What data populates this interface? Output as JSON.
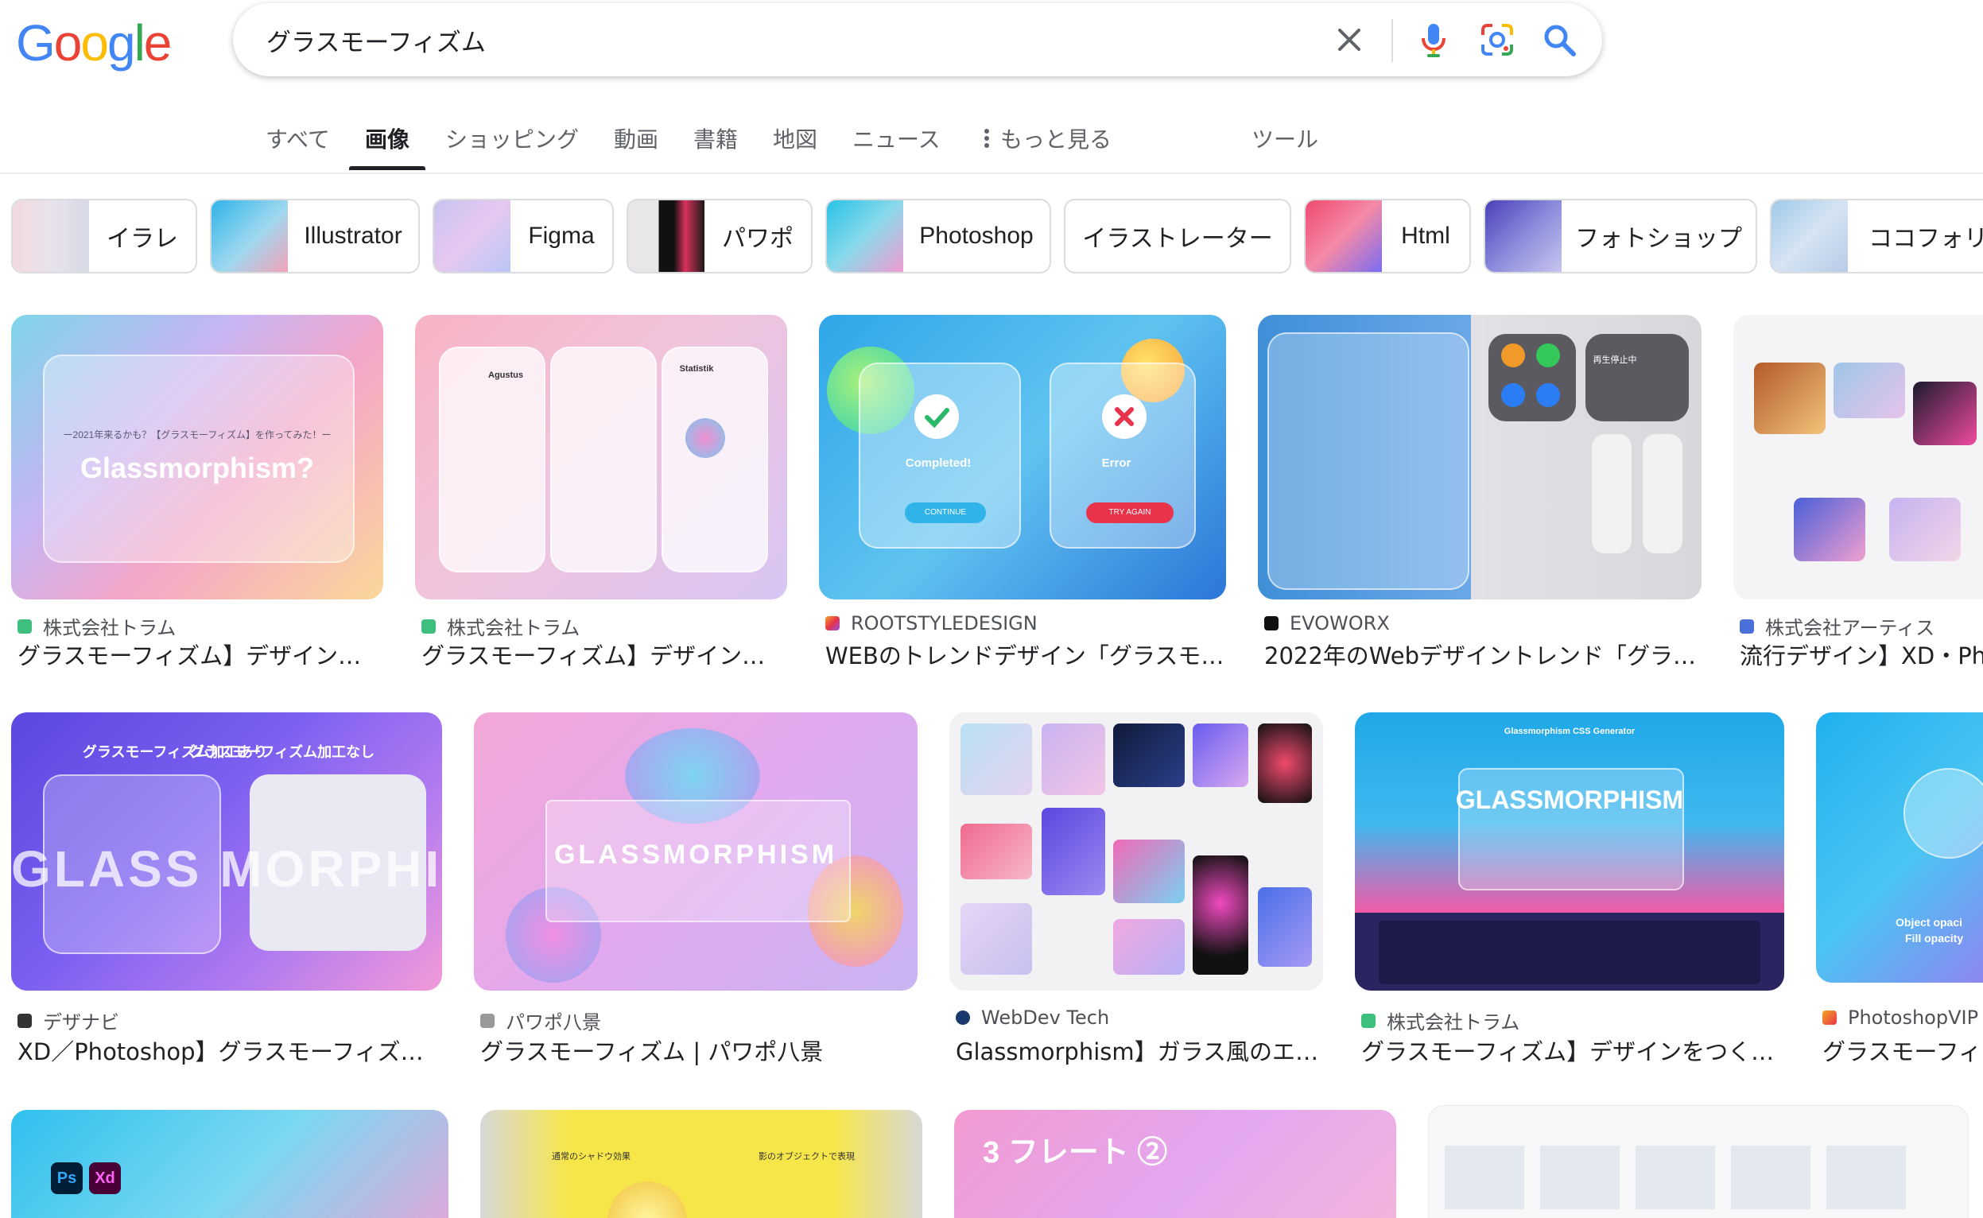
{
  "logo": "Google",
  "search": {
    "query": "グラスモーフィズム"
  },
  "tabs": [
    {
      "label": "すべて"
    },
    {
      "label": "画像"
    },
    {
      "label": "ショッピング"
    },
    {
      "label": "動画"
    },
    {
      "label": "書籍"
    },
    {
      "label": "地図"
    },
    {
      "label": "ニュース"
    },
    {
      "label": "もっと見る"
    },
    {
      "label": "ツール"
    }
  ],
  "active_tab": "画像",
  "chips": [
    {
      "label": "イラレ"
    },
    {
      "label": "Illustrator"
    },
    {
      "label": "Figma"
    },
    {
      "label": "パワポ"
    },
    {
      "label": "Photoshop"
    },
    {
      "label": "イラストレーター"
    },
    {
      "label": "Html"
    },
    {
      "label": "フォトショップ"
    },
    {
      "label": "ココフォリア"
    }
  ],
  "results": [
    {
      "source": "株式会社トラム",
      "title": "グラスモーフィズム】デザインを…",
      "thumb_text": "Glassmorphism?",
      "thumb_sub": "ー2021年来るかも？【グラスモーフィズム】を作ってみた！ー"
    },
    {
      "source": "株式会社トラム",
      "title": "グラスモーフィズム】デザインを…",
      "thumb_text": "Agustus",
      "thumb_sub": "Statistik"
    },
    {
      "source": "ROOTSTYLEDESIGN",
      "title": "WEBのトレンドデザイン「グラスモ…",
      "thumb_text": "Completed!",
      "thumb_sub": "Error",
      "btn1": "CONTINUE",
      "btn2": "TRY AGAIN"
    },
    {
      "source": "EVOWORX",
      "title": "2022年のWebデザイントレンド「グラ…",
      "thumb_text": "再生停止中"
    },
    {
      "source": "株式会社アーティス",
      "title": "流行デザイン】XD・Pho"
    },
    {
      "source": "デザナビ",
      "title": "XD／Photoshop】グラスモーフィズム…",
      "thumb_text": "グラスモーフィズム加工あり",
      "thumb_sub": "グラスモーフィズム加工なし",
      "thumb_big": "GLASS MORPHISM"
    },
    {
      "source": "パワポ八景",
      "title": "グラスモーフィズム | パワポ八景",
      "thumb_text": "GLASSMORPHISM"
    },
    {
      "source": "WebDev Tech",
      "title": "Glassmorphism】ガラス風のエフ…"
    },
    {
      "source": "株式会社トラム",
      "title": "グラスモーフィズム】デザインをつく…",
      "thumb_text": "GLASSMORPHISM",
      "thumb_sub": "Glassmorphism CSS Generator"
    },
    {
      "source": "PhotoshopVIP",
      "title": "グラスモーフィズ",
      "thumb_text": "Object opaci",
      "thumb_sub": "Fill opacity"
    }
  ],
  "row3": [
    {
      "thumb_text": "Ps",
      "thumb_sub": "Xd"
    },
    {
      "thumb_text": "通常のシャドウ効果",
      "thumb_sub": "影のオブジェクトで表現"
    },
    {
      "thumb_text": "3 フレート ②"
    },
    {
      "thumb_text": ""
    }
  ]
}
